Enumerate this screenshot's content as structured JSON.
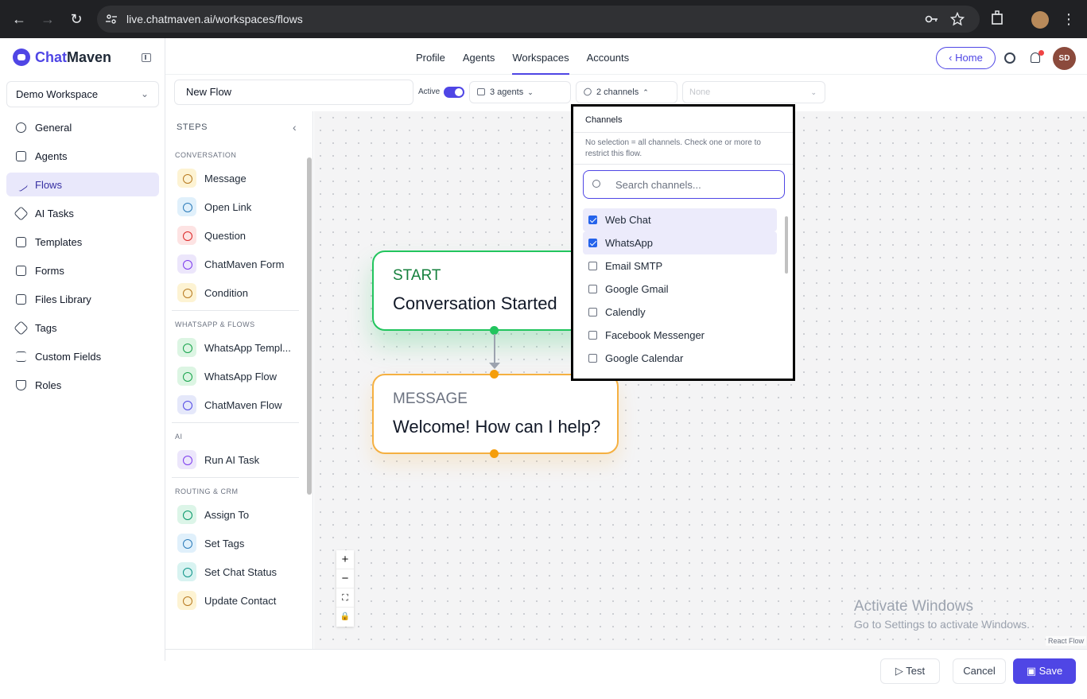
{
  "browser": {
    "url": "live.chatmaven.ai/workspaces/flows"
  },
  "app": {
    "logo_part1": "Chat",
    "logo_part2": "Maven"
  },
  "header": {
    "tabs": [
      {
        "label": "Profile"
      },
      {
        "label": "Agents"
      },
      {
        "label": "Workspaces",
        "active": true
      },
      {
        "label": "Accounts"
      }
    ],
    "home_label": "Home",
    "user_initials": "SD"
  },
  "sidebar": {
    "workspace": "Demo Workspace",
    "items": [
      {
        "label": "General",
        "icon": "gear-icon"
      },
      {
        "label": "Agents",
        "icon": "bot-icon"
      },
      {
        "label": "Flows",
        "icon": "flow-icon",
        "active": true
      },
      {
        "label": "AI Tasks",
        "icon": "sparkle-icon"
      },
      {
        "label": "Templates",
        "icon": "file-icon"
      },
      {
        "label": "Forms",
        "icon": "clipboard-icon"
      },
      {
        "label": "Files Library",
        "icon": "files-icon"
      },
      {
        "label": "Tags",
        "icon": "tag-icon"
      },
      {
        "label": "Custom Fields",
        "icon": "list-icon"
      },
      {
        "label": "Roles",
        "icon": "shield-icon"
      }
    ]
  },
  "toolbar": {
    "flow_name": "New Flow",
    "active_label": "Active",
    "agents_label": "3 agents",
    "channels_label": "2 channels",
    "none_label": "None"
  },
  "steps": {
    "title": "STEPS",
    "sections": [
      {
        "title": "CONVERSATION",
        "items": [
          "Message",
          "Open Link",
          "Question",
          "ChatMaven Form",
          "Condition"
        ]
      },
      {
        "title": "WHATSAPP & FLOWS",
        "items": [
          "WhatsApp Templ...",
          "WhatsApp Flow",
          "ChatMaven Flow"
        ]
      },
      {
        "title": "AI",
        "items": [
          "Run AI Task"
        ]
      },
      {
        "title": "ROUTING & CRM",
        "items": [
          "Assign To",
          "Set Tags",
          "Set Chat Status",
          "Update Contact"
        ]
      }
    ]
  },
  "canvas": {
    "start_type": "START",
    "start_title": "Conversation Started",
    "message_type": "MESSAGE",
    "message_title": "Welcome! How can I help?",
    "zoom": [
      "+",
      "−",
      "⛶",
      "🔒"
    ],
    "watermark1": "Activate Windows",
    "watermark2": "Go to Settings to activate Windows.",
    "attribution": "React Flow"
  },
  "channels_dropdown": {
    "title": "Channels",
    "help": "No selection = all channels. Check one or more to restrict this flow.",
    "search_placeholder": "Search channels...",
    "items": [
      {
        "label": "Web Chat",
        "checked": true
      },
      {
        "label": "WhatsApp",
        "checked": true
      },
      {
        "label": "Email SMTP",
        "checked": false
      },
      {
        "label": "Google Gmail",
        "checked": false
      },
      {
        "label": "Calendly",
        "checked": false
      },
      {
        "label": "Facebook Messenger",
        "checked": false
      },
      {
        "label": "Google Calendar",
        "checked": false
      }
    ]
  },
  "footer": {
    "test_label": "Test",
    "cancel_label": "Cancel",
    "save_label": "Save"
  },
  "colors": {
    "accent": "#4f46e5",
    "start_node": "#22c55e",
    "message_node": "#f5b041"
  }
}
